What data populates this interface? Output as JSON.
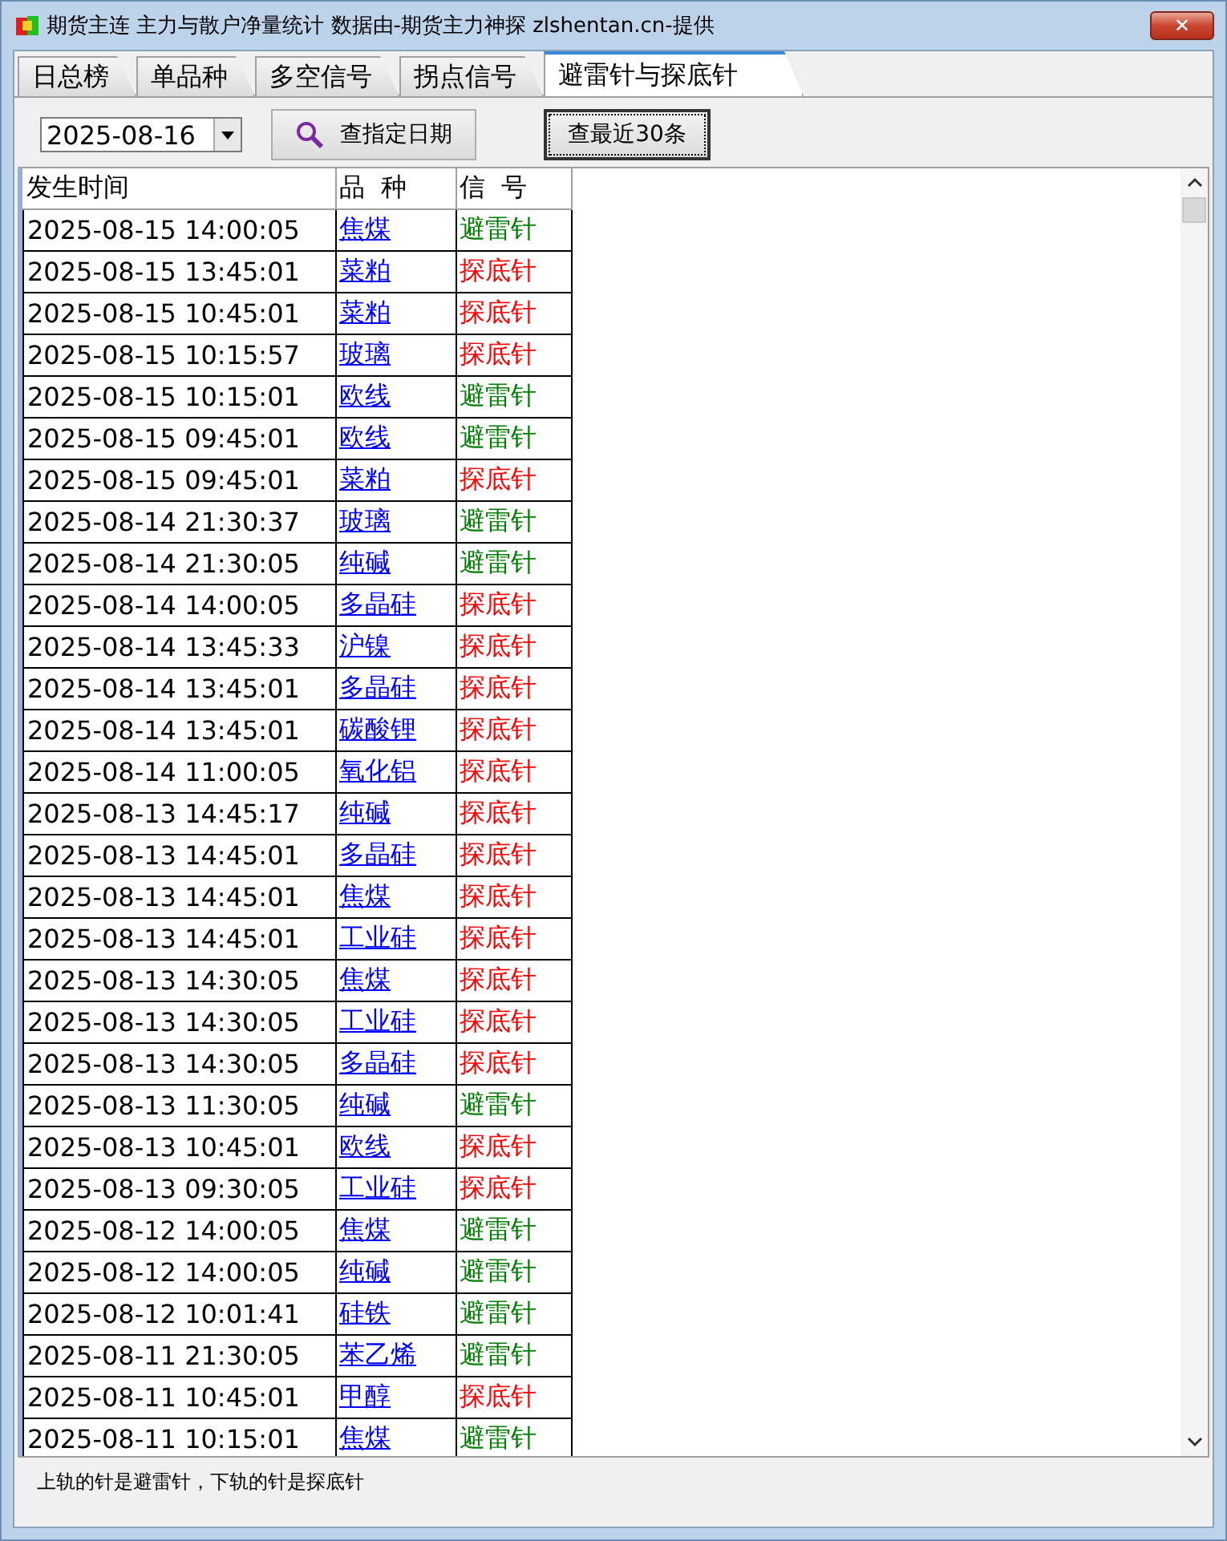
{
  "window": {
    "title": "期货主连 主力与散户净量统计 数据由-期货主力神探 zlshentan.cn-提供",
    "close": "✕"
  },
  "tabs": [
    {
      "label": "日总榜",
      "selected": false
    },
    {
      "label": "单品种",
      "selected": false
    },
    {
      "label": "多空信号",
      "selected": false
    },
    {
      "label": "拐点信号",
      "selected": false
    },
    {
      "label": "避雷针与探底针",
      "selected": true
    }
  ],
  "toolbar": {
    "date": "2025-08-16",
    "query_button": "查指定日期",
    "recent_button": "查最近30条"
  },
  "table": {
    "columns": [
      "发生时间",
      "品  种",
      "信  号"
    ],
    "rows": [
      {
        "time": "2025-08-15 14:00:05",
        "variety": "焦煤",
        "signal": "避雷针",
        "kind": "top"
      },
      {
        "time": "2025-08-15 13:45:01",
        "variety": "菜粕",
        "signal": "探底针",
        "kind": "bottom"
      },
      {
        "time": "2025-08-15 10:45:01",
        "variety": "菜粕",
        "signal": "探底针",
        "kind": "bottom"
      },
      {
        "time": "2025-08-15 10:15:57",
        "variety": "玻璃",
        "signal": "探底针",
        "kind": "bottom"
      },
      {
        "time": "2025-08-15 10:15:01",
        "variety": "欧线",
        "signal": "避雷针",
        "kind": "top"
      },
      {
        "time": "2025-08-15 09:45:01",
        "variety": "欧线",
        "signal": "避雷针",
        "kind": "top"
      },
      {
        "time": "2025-08-15 09:45:01",
        "variety": "菜粕",
        "signal": "探底针",
        "kind": "bottom"
      },
      {
        "time": "2025-08-14 21:30:37",
        "variety": "玻璃",
        "signal": "避雷针",
        "kind": "top"
      },
      {
        "time": "2025-08-14 21:30:05",
        "variety": "纯碱",
        "signal": "避雷针",
        "kind": "top"
      },
      {
        "time": "2025-08-14 14:00:05",
        "variety": "多晶硅",
        "signal": "探底针",
        "kind": "bottom"
      },
      {
        "time": "2025-08-14 13:45:33",
        "variety": "沪镍",
        "signal": "探底针",
        "kind": "bottom"
      },
      {
        "time": "2025-08-14 13:45:01",
        "variety": "多晶硅",
        "signal": "探底针",
        "kind": "bottom"
      },
      {
        "time": "2025-08-14 13:45:01",
        "variety": "碳酸锂",
        "signal": "探底针",
        "kind": "bottom"
      },
      {
        "time": "2025-08-14 11:00:05",
        "variety": "氧化铝",
        "signal": "探底针",
        "kind": "bottom"
      },
      {
        "time": "2025-08-13 14:45:17",
        "variety": "纯碱",
        "signal": "探底针",
        "kind": "bottom"
      },
      {
        "time": "2025-08-13 14:45:01",
        "variety": "多晶硅",
        "signal": "探底针",
        "kind": "bottom"
      },
      {
        "time": "2025-08-13 14:45:01",
        "variety": "焦煤",
        "signal": "探底针",
        "kind": "bottom"
      },
      {
        "time": "2025-08-13 14:45:01",
        "variety": "工业硅",
        "signal": "探底针",
        "kind": "bottom"
      },
      {
        "time": "2025-08-13 14:30:05",
        "variety": "焦煤",
        "signal": "探底针",
        "kind": "bottom"
      },
      {
        "time": "2025-08-13 14:30:05",
        "variety": "工业硅",
        "signal": "探底针",
        "kind": "bottom"
      },
      {
        "time": "2025-08-13 14:30:05",
        "variety": "多晶硅",
        "signal": "探底针",
        "kind": "bottom"
      },
      {
        "time": "2025-08-13 11:30:05",
        "variety": "纯碱",
        "signal": "避雷针",
        "kind": "top"
      },
      {
        "time": "2025-08-13 10:45:01",
        "variety": "欧线",
        "signal": "探底针",
        "kind": "bottom"
      },
      {
        "time": "2025-08-13 09:30:05",
        "variety": "工业硅",
        "signal": "探底针",
        "kind": "bottom"
      },
      {
        "time": "2025-08-12 14:00:05",
        "variety": "焦煤",
        "signal": "避雷针",
        "kind": "top"
      },
      {
        "time": "2025-08-12 14:00:05",
        "variety": "纯碱",
        "signal": "避雷针",
        "kind": "top"
      },
      {
        "time": "2025-08-12 10:01:41",
        "variety": "硅铁",
        "signal": "避雷针",
        "kind": "top"
      },
      {
        "time": "2025-08-11 21:30:05",
        "variety": "苯乙烯",
        "signal": "避雷针",
        "kind": "top"
      },
      {
        "time": "2025-08-11 10:45:01",
        "variety": "甲醇",
        "signal": "探底针",
        "kind": "bottom"
      },
      {
        "time": "2025-08-11 10:15:01",
        "variety": "焦煤",
        "signal": "避雷针",
        "kind": "top"
      }
    ]
  },
  "footer": "上轨的针是避雷针，下轨的针是探底针"
}
